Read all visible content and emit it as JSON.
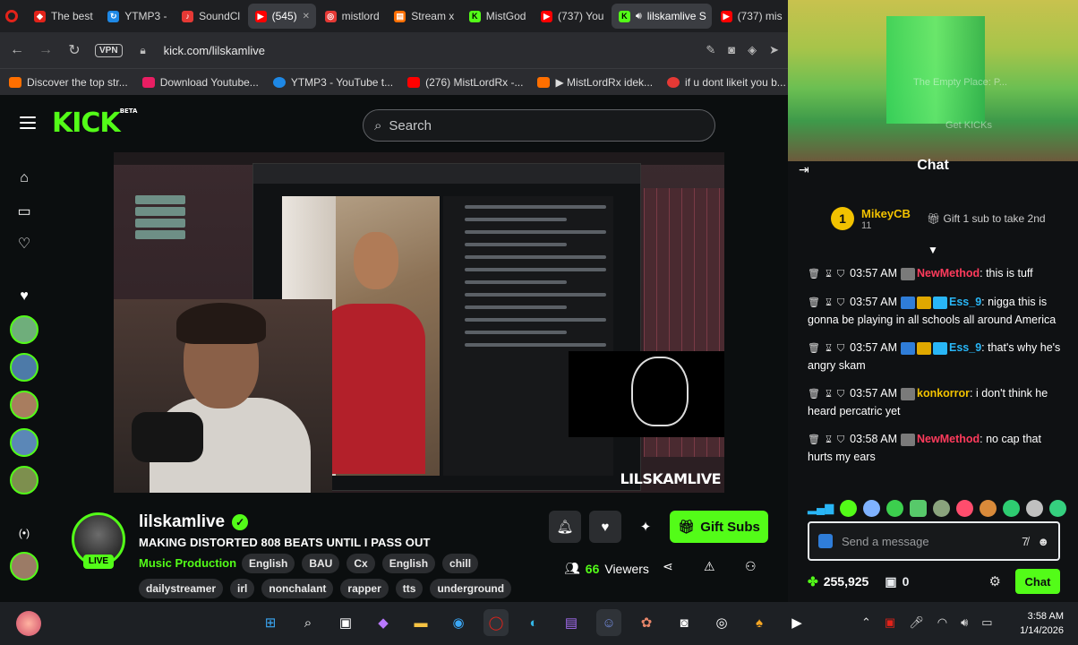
{
  "browser": {
    "tabs": [
      {
        "label": "The best",
        "color": "#e2231a"
      },
      {
        "label": "YTMP3 -",
        "color": "#1e88e5"
      },
      {
        "label": "SoundCl",
        "color": "#e53935"
      },
      {
        "label": "(545)",
        "color": "#ff0000"
      },
      {
        "label": "mistlord",
        "color": "#e53935"
      },
      {
        "label": "Stream x",
        "color": "#ff6f00"
      },
      {
        "label": "MistGod",
        "color": "#53fc18"
      },
      {
        "label": "(737) You",
        "color": "#ff0000"
      },
      {
        "label": "lilskamlive S",
        "color": "#53fc18"
      },
      {
        "label": "(737) mis",
        "color": "#ff0000"
      }
    ],
    "vpn_label": "VPN",
    "url": "kick.com/lilskamlive",
    "bookmarks": [
      {
        "label": "Discover the top str...",
        "color": "#ff6f00"
      },
      {
        "label": "Download Youtube...",
        "color": "#e91e63"
      },
      {
        "label": "YTMP3 - YouTube t...",
        "color": "#1e88e5"
      },
      {
        "label": "(276) MistLordRx -...",
        "color": "#ff0000"
      },
      {
        "label": "▶ MistLordRx idek...",
        "color": "#ff6f00"
      },
      {
        "label": "if u dont likeit you b...",
        "color": "#e53935"
      }
    ]
  },
  "kick": {
    "logo": "KICK",
    "logo_beta": "BETA",
    "search_placeholder": "Search",
    "player": {
      "watermark": "LILSKAMLIVE"
    },
    "channel": {
      "name": "lilskamlive",
      "live_badge": "LIVE",
      "title": "MAKING DISTORTED 808 BEATS UNTIL I PASS OUT",
      "category": "Music Production",
      "tags_row1": [
        "English",
        "BAU",
        "Cx",
        "English",
        "chill"
      ],
      "tags_row2": [
        "dailystreamer",
        "irl",
        "nonchalant",
        "rapper",
        "tts",
        "underground"
      ],
      "gift_button": "Gift Subs",
      "viewers_count": "66",
      "viewers_label": "Viewers"
    }
  },
  "chat": {
    "header": "Chat",
    "overlay_texts": [
      "Get KICKs",
      "The Empty Place: P..."
    ],
    "pinned": {
      "rank": "1",
      "user": "MikeyCB",
      "count": "11",
      "gift_text": "Gift 1 sub to take 2nd"
    },
    "messages": [
      {
        "time": "03:57 AM",
        "user": "NewMethod",
        "user_color": "#ff3b5c",
        "text": ": this is tuff"
      },
      {
        "time": "03:57 AM",
        "user": "Ess_9",
        "user_color": "#29b6f6",
        "text": ": nigga this is gonna be playing in all schools all around America"
      },
      {
        "time": "03:57 AM",
        "user": "Ess_9",
        "user_color": "#29b6f6",
        "text": ": that's why he's angry skam"
      },
      {
        "time": "03:57 AM",
        "user": "konkorror",
        "user_color": "#f2c200",
        "text": ": i don't think he heard percatric yet"
      },
      {
        "time": "03:58 AM",
        "user": "NewMethod",
        "user_color": "#ff3b5c",
        "text": ": no cap that hurts my ears"
      }
    ],
    "input_placeholder": "Send a message",
    "points": "255,925",
    "box_count": "0",
    "send_label": "Chat"
  },
  "taskbar": {
    "time": "3:58 AM",
    "date": "1/14/2026"
  }
}
